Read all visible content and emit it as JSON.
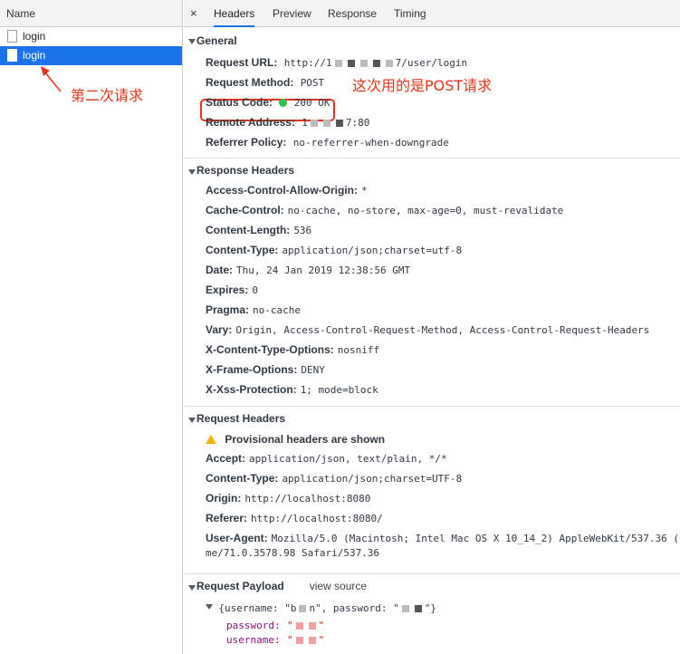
{
  "left_panel": {
    "header": "Name",
    "requests": [
      {
        "name": "login",
        "selected": false
      },
      {
        "name": "login",
        "selected": true
      }
    ]
  },
  "annotations": {
    "second_request": "第二次请求",
    "post_note": "这次用的是POST请求",
    "color": "#e5341b"
  },
  "tabs": {
    "close": "×",
    "items": [
      "Headers",
      "Preview",
      "Response",
      "Timing"
    ],
    "active": "Headers"
  },
  "general": {
    "title": "General",
    "request_url_key": "Request URL:",
    "request_url_prefix": "http://1",
    "request_url_suffix": "7/user/login",
    "request_method_key": "Request Method:",
    "request_method_value": "POST",
    "status_code_key": "Status Code:",
    "status_code_value": "200 OK",
    "remote_address_key": "Remote Address:",
    "remote_address_prefix": "1",
    "remote_address_suffix": "7:80",
    "referrer_policy_key": "Referrer Policy:",
    "referrer_policy_value": "no-referrer-when-downgrade"
  },
  "response_headers": {
    "title": "Response Headers",
    "items": [
      {
        "k": "Access-Control-Allow-Origin:",
        "v": "*"
      },
      {
        "k": "Cache-Control:",
        "v": "no-cache, no-store, max-age=0, must-revalidate"
      },
      {
        "k": "Content-Length:",
        "v": "536"
      },
      {
        "k": "Content-Type:",
        "v": "application/json;charset=utf-8"
      },
      {
        "k": "Date:",
        "v": "Thu, 24 Jan 2019 12:38:56 GMT"
      },
      {
        "k": "Expires:",
        "v": "0"
      },
      {
        "k": "Pragma:",
        "v": "no-cache"
      },
      {
        "k": "Vary:",
        "v": "Origin, Access-Control-Request-Method, Access-Control-Request-Headers"
      },
      {
        "k": "X-Content-Type-Options:",
        "v": "nosniff"
      },
      {
        "k": "X-Frame-Options:",
        "v": "DENY"
      },
      {
        "k": "X-Xss-Protection:",
        "v": "1; mode=block"
      }
    ]
  },
  "request_headers": {
    "title": "Request Headers",
    "provisional": "Provisional headers are shown",
    "items": [
      {
        "k": "Accept:",
        "v": "application/json, text/plain, */*"
      },
      {
        "k": "Content-Type:",
        "v": "application/json;charset=UTF-8"
      },
      {
        "k": "Origin:",
        "v": "http://localhost:8080"
      },
      {
        "k": "Referer:",
        "v": "http://localhost:8080/"
      },
      {
        "k": "User-Agent:",
        "v": "Mozilla/5.0 (Macintosh; Intel Mac OS X 10_14_2) AppleWebKit/537.36 ("
      }
    ],
    "user_agent_cont": "me/71.0.3578.98 Safari/537.36"
  },
  "request_payload": {
    "title": "Request Payload",
    "view_source": "view source",
    "summary_prefix": "{username: \"b",
    "summary_middle": "n\", password: \"",
    "summary_suffix": "\"}",
    "password_key": "password:",
    "password_value_start": "\"",
    "password_value_end": "\"",
    "username_key": "username:",
    "username_value_start": "\"",
    "username_value_end": "\""
  }
}
